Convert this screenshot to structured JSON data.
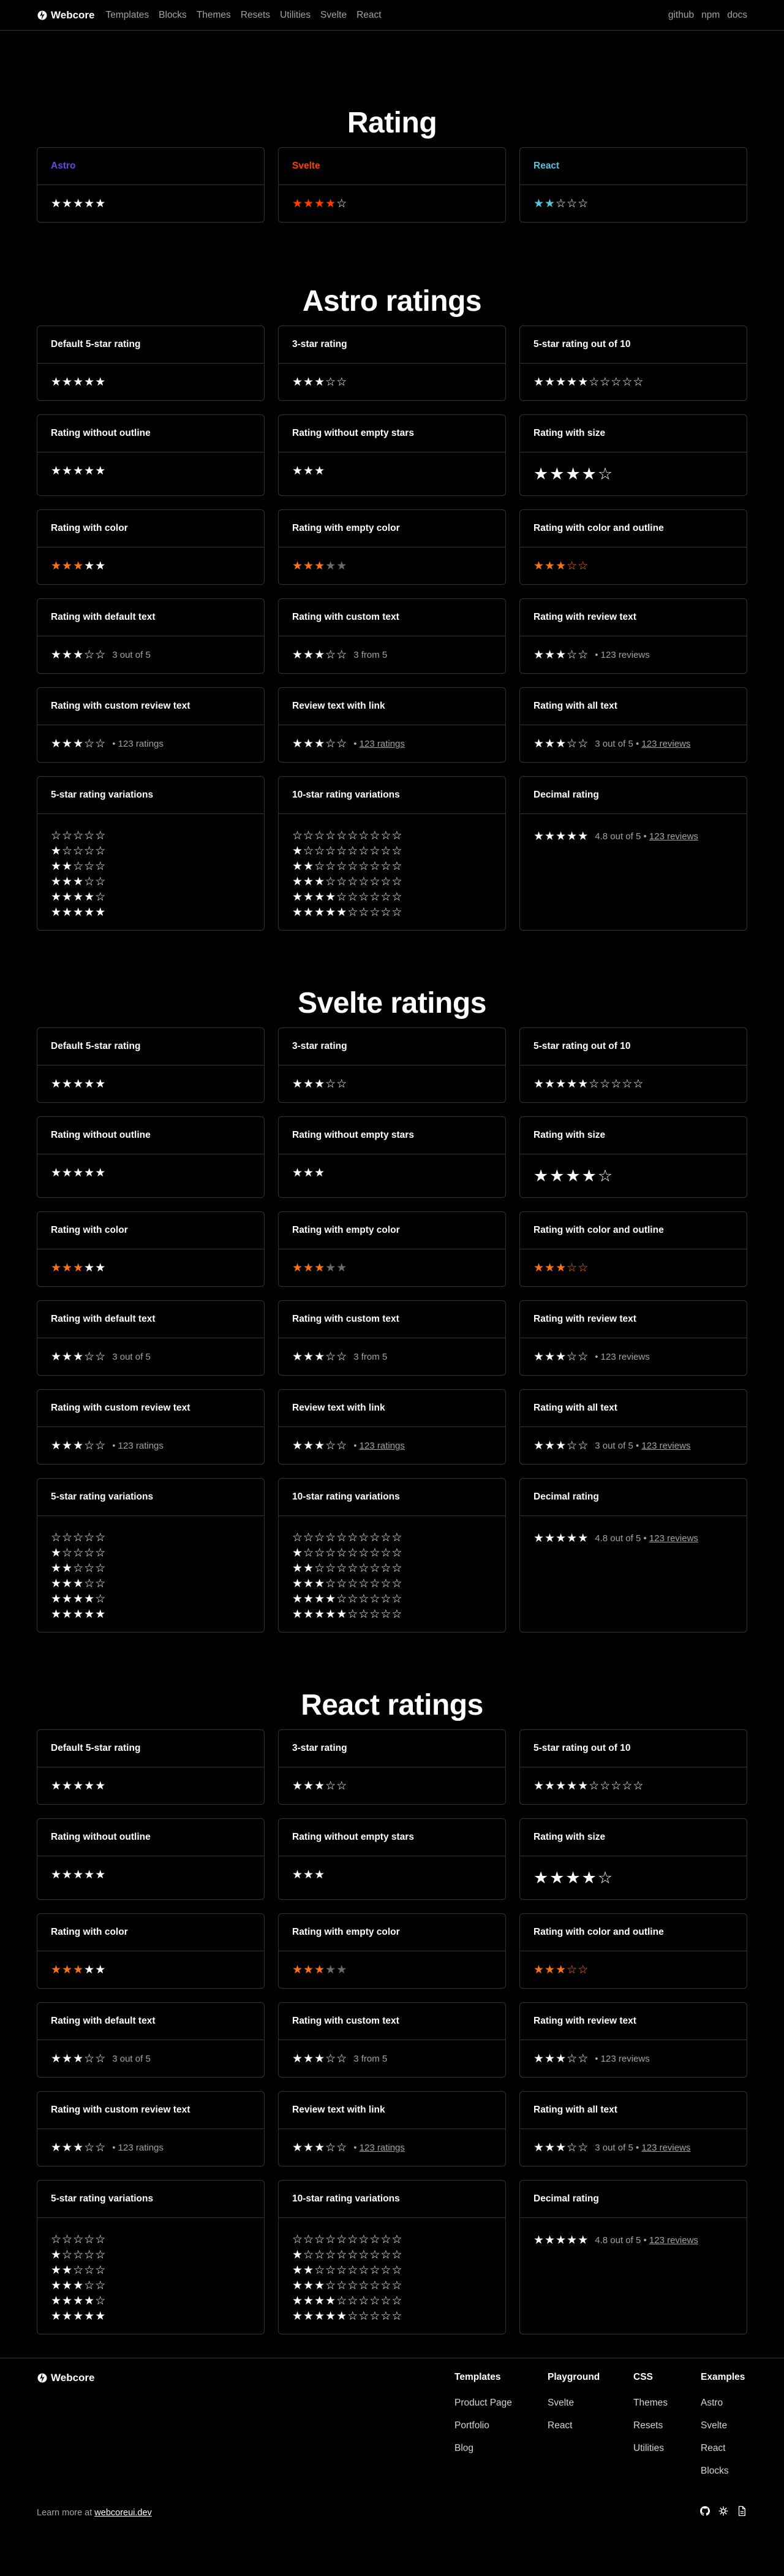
{
  "nav": {
    "brand": "Webcore",
    "links": [
      "Templates",
      "Blocks",
      "Themes",
      "Resets",
      "Utilities",
      "Svelte",
      "React"
    ],
    "right_links": [
      "github",
      "npm",
      "docs"
    ]
  },
  "main": {
    "title": "Rating",
    "cards": [
      {
        "title": "Astro",
        "title_color": "#5b4ee3",
        "value": 5,
        "total": 5,
        "color": "#ffffff"
      },
      {
        "title": "Svelte",
        "title_color": "#ff3e00",
        "value": 4,
        "total": 5,
        "color": "#ff3e00"
      },
      {
        "title": "React",
        "title_color": "#58c4dc",
        "value": 2,
        "total": 5,
        "color": "#58c4dc"
      }
    ]
  },
  "sections": [
    {
      "id": "astro",
      "title": "Astro ratings",
      "cards": [
        {
          "title": "Default 5-star rating",
          "kind": "std",
          "value": 5,
          "total": 5
        },
        {
          "title": "3-star rating",
          "kind": "std",
          "value": 3,
          "total": 5
        },
        {
          "title": "5-star rating out of 10",
          "kind": "std",
          "value": 5,
          "total": 10
        },
        {
          "title": "Rating without outline",
          "kind": "std",
          "value": 5,
          "total": 5
        },
        {
          "title": "Rating without empty stars",
          "kind": "std",
          "value": 3,
          "total": 3
        },
        {
          "title": "Rating with size",
          "kind": "size",
          "value": 4,
          "total": 5
        },
        {
          "title": "Rating with color",
          "kind": "std",
          "value": 3,
          "total": 5,
          "color": "#f97316",
          "empty": "full-white"
        },
        {
          "title": "Rating with empty color",
          "kind": "std",
          "value": 3,
          "total": 5,
          "color": "#f97316",
          "empty": "full-gray"
        },
        {
          "title": "Rating with color and outline",
          "kind": "std",
          "value": 3,
          "total": 5,
          "color": "#f97316",
          "empty": "outline-color"
        },
        {
          "title": "Rating with default text",
          "kind": "std",
          "value": 3,
          "total": 5,
          "text": "3 out of 5"
        },
        {
          "title": "Rating with custom text",
          "kind": "std",
          "value": 3,
          "total": 5,
          "text": "3 from 5"
        },
        {
          "title": "Rating with review text",
          "kind": "std",
          "value": 3,
          "total": 5,
          "reviews": "123 reviews"
        },
        {
          "title": "Rating with custom review text",
          "kind": "std",
          "value": 3,
          "total": 5,
          "reviews": "123 ratings"
        },
        {
          "title": "Review text with link",
          "kind": "std",
          "value": 3,
          "total": 5,
          "link": "123 ratings"
        },
        {
          "title": "Rating with all text",
          "kind": "std",
          "value": 3,
          "total": 5,
          "text": "3 out of 5",
          "link": "123 reviews"
        },
        {
          "title": "5-star rating variations",
          "kind": "var",
          "values": [
            0,
            1,
            2,
            3,
            4,
            5
          ],
          "total": 5
        },
        {
          "title": "10-star rating variations",
          "kind": "var",
          "values": [
            0,
            1,
            2,
            3,
            4,
            5
          ],
          "total": 10
        },
        {
          "title": "Decimal rating",
          "kind": "dec",
          "value": 5,
          "total": 5,
          "text": "4.8 out of 5",
          "link": "123 reviews"
        }
      ]
    },
    {
      "id": "svelte",
      "title": "Svelte ratings",
      "cards": [
        {
          "title": "Default 5-star rating",
          "kind": "std",
          "value": 5,
          "total": 5
        },
        {
          "title": "3-star rating",
          "kind": "std",
          "value": 3,
          "total": 5
        },
        {
          "title": "5-star rating out of 10",
          "kind": "std",
          "value": 5,
          "total": 10
        },
        {
          "title": "Rating without outline",
          "kind": "std",
          "value": 5,
          "total": 5
        },
        {
          "title": "Rating without empty stars",
          "kind": "std",
          "value": 3,
          "total": 3
        },
        {
          "title": "Rating with size",
          "kind": "size",
          "value": 4,
          "total": 5
        },
        {
          "title": "Rating with color",
          "kind": "std",
          "value": 3,
          "total": 5,
          "color": "#f97316",
          "empty": "full-white"
        },
        {
          "title": "Rating with empty color",
          "kind": "std",
          "value": 3,
          "total": 5,
          "color": "#f97316",
          "empty": "full-gray"
        },
        {
          "title": "Rating with color and outline",
          "kind": "std",
          "value": 3,
          "total": 5,
          "color": "#f97316",
          "empty": "outline-color"
        },
        {
          "title": "Rating with default text",
          "kind": "std",
          "value": 3,
          "total": 5,
          "text": "3 out of 5"
        },
        {
          "title": "Rating with custom text",
          "kind": "std",
          "value": 3,
          "total": 5,
          "text": "3 from 5"
        },
        {
          "title": "Rating with review text",
          "kind": "std",
          "value": 3,
          "total": 5,
          "reviews": "123 reviews"
        },
        {
          "title": "Rating with custom review text",
          "kind": "std",
          "value": 3,
          "total": 5,
          "reviews": "123 ratings"
        },
        {
          "title": "Review text with link",
          "kind": "std",
          "value": 3,
          "total": 5,
          "link": "123 ratings"
        },
        {
          "title": "Rating with all text",
          "kind": "std",
          "value": 3,
          "total": 5,
          "text": "3 out of 5",
          "link": "123 reviews"
        },
        {
          "title": "5-star rating variations",
          "kind": "var",
          "values": [
            0,
            1,
            2,
            3,
            4,
            5
          ],
          "total": 5
        },
        {
          "title": "10-star rating variations",
          "kind": "var",
          "values": [
            0,
            1,
            2,
            3,
            4,
            5
          ],
          "total": 10
        },
        {
          "title": "Decimal rating",
          "kind": "dec",
          "value": 5,
          "total": 5,
          "text": "4.8 out of 5",
          "link": "123 reviews"
        }
      ]
    },
    {
      "id": "react",
      "title": "React ratings",
      "cards": [
        {
          "title": "Default 5-star rating",
          "kind": "std",
          "value": 5,
          "total": 5
        },
        {
          "title": "3-star rating",
          "kind": "std",
          "value": 3,
          "total": 5
        },
        {
          "title": "5-star rating out of 10",
          "kind": "std",
          "value": 5,
          "total": 10
        },
        {
          "title": "Rating without outline",
          "kind": "std",
          "value": 5,
          "total": 5
        },
        {
          "title": "Rating without empty stars",
          "kind": "std",
          "value": 3,
          "total": 3
        },
        {
          "title": "Rating with size",
          "kind": "size",
          "value": 4,
          "total": 5
        },
        {
          "title": "Rating with color",
          "kind": "std",
          "value": 3,
          "total": 5,
          "color": "#f97316",
          "empty": "full-white"
        },
        {
          "title": "Rating with empty color",
          "kind": "std",
          "value": 3,
          "total": 5,
          "color": "#f97316",
          "empty": "full-gray"
        },
        {
          "title": "Rating with color and outline",
          "kind": "std",
          "value": 3,
          "total": 5,
          "color": "#f97316",
          "empty": "outline-color"
        },
        {
          "title": "Rating with default text",
          "kind": "std",
          "value": 3,
          "total": 5,
          "text": "3 out of 5"
        },
        {
          "title": "Rating with custom text",
          "kind": "std",
          "value": 3,
          "total": 5,
          "text": "3 from 5"
        },
        {
          "title": "Rating with review text",
          "kind": "std",
          "value": 3,
          "total": 5,
          "reviews": "123 reviews"
        },
        {
          "title": "Rating with custom review text",
          "kind": "std",
          "value": 3,
          "total": 5,
          "reviews": "123 ratings"
        },
        {
          "title": "Review text with link",
          "kind": "std",
          "value": 3,
          "total": 5,
          "link": "123 ratings"
        },
        {
          "title": "Rating with all text",
          "kind": "std",
          "value": 3,
          "total": 5,
          "text": "3 out of 5",
          "link": "123 reviews"
        },
        {
          "title": "5-star rating variations",
          "kind": "var",
          "values": [
            0,
            1,
            2,
            3,
            4,
            5
          ],
          "total": 5
        },
        {
          "title": "10-star rating variations",
          "kind": "var",
          "values": [
            0,
            1,
            2,
            3,
            4,
            5
          ],
          "total": 10
        },
        {
          "title": "Decimal rating",
          "kind": "dec",
          "value": 5,
          "total": 5,
          "text": "4.8 out of 5",
          "link": "123 reviews"
        }
      ]
    }
  ],
  "footer": {
    "brand": "Webcore",
    "columns": [
      {
        "title": "Templates",
        "items": [
          "Product Page",
          "Portfolio",
          "Blog"
        ]
      },
      {
        "title": "Playground",
        "items": [
          "Svelte",
          "React"
        ]
      },
      {
        "title": "CSS",
        "items": [
          "Themes",
          "Resets",
          "Utilities"
        ]
      },
      {
        "title": "Examples",
        "items": [
          "Astro",
          "Svelte",
          "React",
          "Blocks"
        ]
      }
    ],
    "note": "Learn more at",
    "note_link": "webcoreui.dev",
    "icons": [
      "github-icon",
      "npm-icon",
      "docs-icon"
    ]
  }
}
